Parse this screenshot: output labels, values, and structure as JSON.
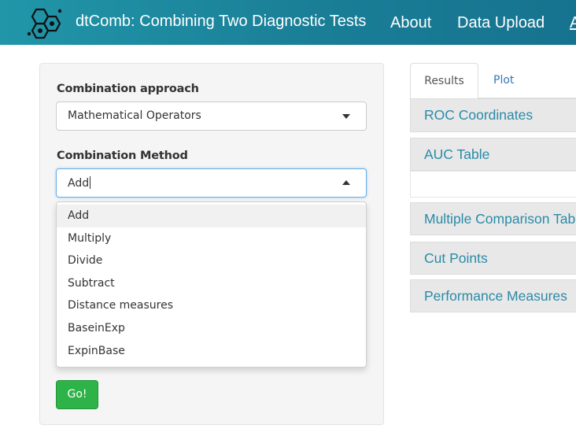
{
  "navbar": {
    "title": "dtComb: Combining Two Diagnostic Tests",
    "items": [
      "About",
      "Data Upload",
      "A"
    ]
  },
  "sidebar": {
    "approach_label": "Combination approach",
    "approach_value": "Mathematical Operators",
    "method_label": "Combination Method",
    "method_value": "Add",
    "method_options": [
      "Add",
      "Multiply",
      "Divide",
      "Subtract",
      "Distance measures",
      "BaseinExp",
      "ExpinBase"
    ],
    "go_label": "Go!"
  },
  "tabs": [
    "Results",
    "Plot"
  ],
  "panels": [
    "ROC Coordinates",
    "AUC Table",
    "Multiple Comparison Table",
    "Cut Points",
    "Performance Measures"
  ],
  "colors": {
    "navbar": "#1a7e97",
    "go_button": "#2eb348",
    "panel_text": "#2a8ba8",
    "link": "#337ab7"
  }
}
